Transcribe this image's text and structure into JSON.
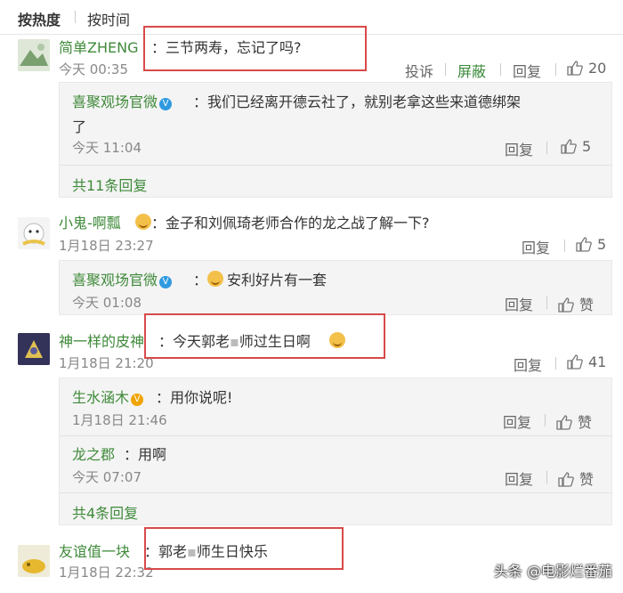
{
  "sort": {
    "tab1": "按热度",
    "tab2": "按时间"
  },
  "comments": [
    {
      "user": "简单ZHENG",
      "text": "三节两寿，忘记了吗?",
      "time": "今天 00:35",
      "report": "投诉",
      "block": "屏蔽",
      "reply": "回复",
      "likes": "20",
      "replies": [
        {
          "user": "喜聚观场官微",
          "text1": "我们已经离开德云社了，就别老拿这些来道德绑架",
          "text2": "了",
          "time": "今天 11:04",
          "reply": "回复",
          "likes": "5"
        }
      ],
      "more": "共11条回复"
    },
    {
      "user": "小鬼-啊瓢",
      "text": "金子和刘佩琦老师合作的龙之战了解一下?",
      "time": "1月18日 23:27",
      "reply": "回复",
      "likes": "5",
      "replies": [
        {
          "user": "喜聚观场官微",
          "text": "安利好片有一套",
          "time": "今天 01:08",
          "reply": "回复",
          "likes": "赞"
        }
      ]
    },
    {
      "user": "神一样的皮神",
      "text_a": "今天郭老",
      "text_b": "师过生日啊",
      "time": "1月18日 21:20",
      "reply": "回复",
      "likes": "41",
      "replies": [
        {
          "user": "生水涵木",
          "text": "用你说呢!",
          "time": "1月18日 21:46",
          "reply": "回复",
          "likes": "赞"
        },
        {
          "user": "龙之郡",
          "text": "用啊",
          "time": "今天 07:07",
          "reply": "回复",
          "likes": "赞"
        }
      ],
      "more": "共4条回复"
    },
    {
      "user": "友谊值一块",
      "text_a": "郭老",
      "text_b": "师生日快乐",
      "time": "1月18日 22:32"
    }
  ],
  "colon": "：",
  "v_badge": "V",
  "watermark": "头条 @电影烂番茄"
}
